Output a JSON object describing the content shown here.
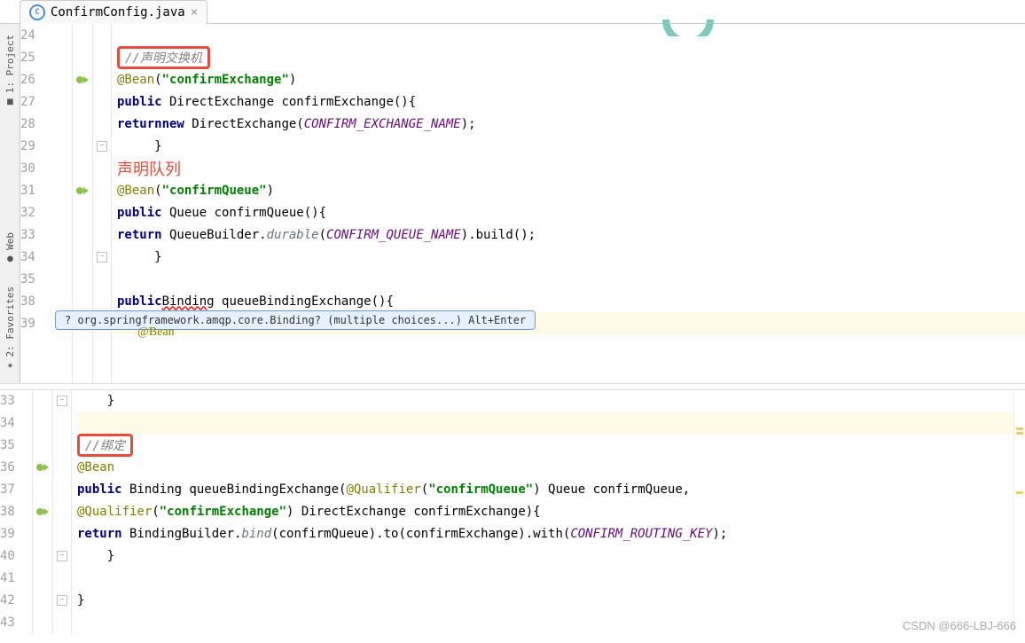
{
  "tab": {
    "filename": "ConfirmConfig.java",
    "close": "×"
  },
  "side": {
    "project": "1: Project",
    "web": "Web",
    "fav": "2: Favorites"
  },
  "hint": {
    "text": "? org.springframework.amqp.core.Binding? (multiple choices...) Alt+Enter"
  },
  "pane1": {
    "lines": [
      {
        "n": 24,
        "segs": []
      },
      {
        "n": 25,
        "segs": [
          {
            "t": "     "
          },
          {
            "t": "//声明交换机",
            "cls": "red-box comment-i"
          }
        ]
      },
      {
        "n": 26,
        "icon": "green",
        "segs": [
          {
            "t": "     "
          },
          {
            "t": "@Bean",
            "cls": "ann"
          },
          {
            "t": "("
          },
          {
            "t": "\"confirmExchange\"",
            "cls": "str"
          },
          {
            "t": ")"
          }
        ]
      },
      {
        "n": 27,
        "segs": [
          {
            "t": "     "
          },
          {
            "t": "public",
            "cls": "kw"
          },
          {
            "t": " DirectExchange confirmExchange(){"
          }
        ]
      },
      {
        "n": 28,
        "segs": [
          {
            "t": "          "
          },
          {
            "t": "return",
            "cls": "kw"
          },
          {
            "t": " "
          },
          {
            "t": "new",
            "cls": "kw"
          },
          {
            "t": " DirectExchange("
          },
          {
            "t": "CONFIRM_EXCHANGE_NAME",
            "cls": "static-ital"
          },
          {
            "t": ");"
          }
        ]
      },
      {
        "n": 29,
        "fold": "e",
        "segs": [
          {
            "t": "     }"
          }
        ]
      },
      {
        "n": 30,
        "segs": [
          {
            "t": "     "
          },
          {
            "t": "声明队列",
            "cls": "red-txt"
          }
        ]
      },
      {
        "n": 31,
        "icon": "green",
        "segs": [
          {
            "t": "     "
          },
          {
            "t": "@Bean",
            "cls": "ann"
          },
          {
            "t": "("
          },
          {
            "t": "\"confirmQueue\"",
            "cls": "str"
          },
          {
            "t": ")"
          }
        ]
      },
      {
        "n": 32,
        "segs": [
          {
            "t": "     "
          },
          {
            "t": "public",
            "cls": "kw"
          },
          {
            "t": " Queue confirmQueue(){"
          }
        ]
      },
      {
        "n": 33,
        "segs": [
          {
            "t": "          "
          },
          {
            "t": "return",
            "cls": "kw"
          },
          {
            "t": " QueueBuilder."
          },
          {
            "t": "durable",
            "cls": "ital"
          },
          {
            "t": "("
          },
          {
            "t": "CONFIRM_QUEUE_NAME",
            "cls": "static-ital"
          },
          {
            "t": ").build();"
          }
        ]
      },
      {
        "n": 34,
        "fold": "e",
        "segs": [
          {
            "t": "     }"
          }
        ]
      },
      {
        "n": 35,
        "segs": []
      },
      {
        "n": 38,
        "segs": [
          {
            "t": "     "
          },
          {
            "t": "public",
            "cls": "kw"
          },
          {
            "t": " "
          },
          {
            "t": "Binding",
            "cls": "red-under"
          },
          {
            "t": " queueBindingExchange(){"
          }
        ]
      },
      {
        "n": 39,
        "hl": true,
        "segs": [
          {
            "t": "          "
          }
        ]
      }
    ],
    "l37": {
      "n": 37,
      "txt": "     @Bean",
      "cls": "ann"
    }
  },
  "pane2": {
    "lines": [
      {
        "n": 33,
        "fold": "e",
        "segs": [
          {
            "t": "    }"
          }
        ]
      },
      {
        "n": 34,
        "hl": true,
        "segs": []
      },
      {
        "n": 35,
        "segs": [
          {
            "t": "    "
          },
          {
            "t": "//绑定",
            "cls": "red-box comment-i"
          }
        ]
      },
      {
        "n": 36,
        "icon": "green",
        "segs": [
          {
            "t": "    "
          },
          {
            "t": "@Bean",
            "cls": "ann"
          }
        ]
      },
      {
        "n": 37,
        "segs": [
          {
            "t": "    "
          },
          {
            "t": "public",
            "cls": "kw"
          },
          {
            "t": " Binding queueBindingExchange("
          },
          {
            "t": "@Qualifier",
            "cls": "ann"
          },
          {
            "t": "("
          },
          {
            "t": "\"confirmQueue\"",
            "cls": "str"
          },
          {
            "t": ") Queue confirmQueue,"
          }
        ]
      },
      {
        "n": 38,
        "icon": "green",
        "segs": [
          {
            "t": "                                        "
          },
          {
            "t": "@Qualifier",
            "cls": "ann"
          },
          {
            "t": "("
          },
          {
            "t": "\"confirmExchange\"",
            "cls": "str"
          },
          {
            "t": ") DirectExchange confirmExchange){"
          }
        ]
      },
      {
        "n": 39,
        "segs": [
          {
            "t": "         "
          },
          {
            "t": "return",
            "cls": "kw"
          },
          {
            "t": " BindingBuilder."
          },
          {
            "t": "bind",
            "cls": "ital"
          },
          {
            "t": "(confirmQueue).to(confirmExchange).with("
          },
          {
            "t": "CONFIRM_ROUTING_KEY",
            "cls": "static-ital"
          },
          {
            "t": ");"
          }
        ]
      },
      {
        "n": 40,
        "fold": "e",
        "segs": [
          {
            "t": "    }"
          }
        ]
      },
      {
        "n": 41,
        "segs": []
      },
      {
        "n": 42,
        "fold": "e",
        "segs": [
          {
            "t": "}"
          }
        ]
      },
      {
        "n": 43,
        "segs": []
      }
    ]
  },
  "watermark": "CSDN @666-LBJ-666"
}
